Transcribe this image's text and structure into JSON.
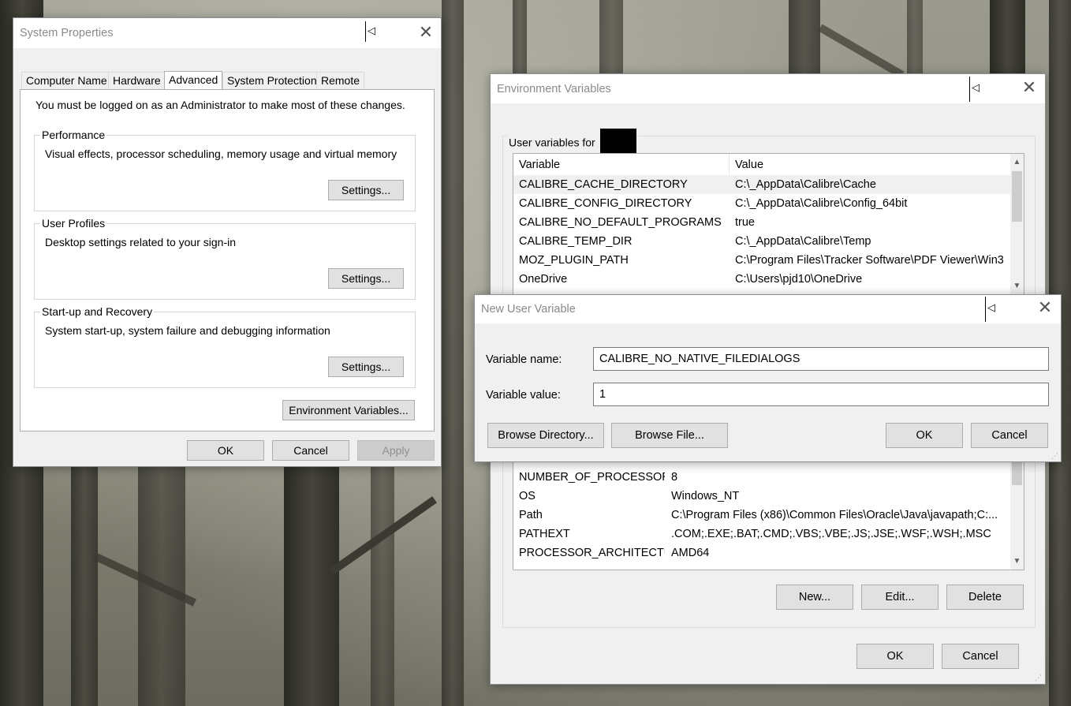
{
  "system_properties": {
    "title": "System Properties",
    "tabs": [
      "Computer Name",
      "Hardware",
      "Advanced",
      "System Protection",
      "Remote"
    ],
    "active_tab": "Advanced",
    "admin_note": "You must be logged on as an Administrator to make most of these changes.",
    "performance": {
      "title": "Performance",
      "desc": "Visual effects, processor scheduling, memory usage and virtual memory",
      "button": "Settings..."
    },
    "user_profiles": {
      "title": "User Profiles",
      "desc": "Desktop settings related to your sign-in",
      "button": "Settings..."
    },
    "startup_recovery": {
      "title": "Start-up and Recovery",
      "desc": "System start-up, system failure and debugging information",
      "button": "Settings..."
    },
    "env_vars_button": "Environment Variables...",
    "ok": "OK",
    "cancel": "Cancel",
    "apply": "Apply"
  },
  "environment_variables": {
    "title": "Environment Variables",
    "user_vars_label": "User variables for",
    "columns": {
      "variable": "Variable",
      "value": "Value"
    },
    "user_rows": [
      {
        "variable": "CALIBRE_CACHE_DIRECTORY",
        "value": "C:\\_AppData\\Calibre\\Cache"
      },
      {
        "variable": "CALIBRE_CONFIG_DIRECTORY",
        "value": "C:\\_AppData\\Calibre\\Config_64bit"
      },
      {
        "variable": "CALIBRE_NO_DEFAULT_PROGRAMS",
        "value": "true"
      },
      {
        "variable": "CALIBRE_TEMP_DIR",
        "value": "C:\\_AppData\\Calibre\\Temp"
      },
      {
        "variable": "MOZ_PLUGIN_PATH",
        "value": "C:\\Program Files\\Tracker Software\\PDF Viewer\\Win3"
      },
      {
        "variable": "OneDrive",
        "value": "C:\\Users\\pjd10\\OneDrive"
      }
    ],
    "system_rows": [
      {
        "variable": "NUMBER_OF_PROCESSORS",
        "value": "8"
      },
      {
        "variable": "OS",
        "value": "Windows_NT"
      },
      {
        "variable": "Path",
        "value": "C:\\Program Files (x86)\\Common Files\\Oracle\\Java\\javapath;C:..."
      },
      {
        "variable": "PATHEXT",
        "value": ".COM;.EXE;.BAT;.CMD;.VBS;.VBE;.JS;.JSE;.WSF;.WSH;.MSC"
      },
      {
        "variable": "PROCESSOR_ARCHITECTU...",
        "value": "AMD64"
      }
    ],
    "new_button": "New...",
    "edit_button": "Edit...",
    "delete_button": "Delete",
    "ok": "OK",
    "cancel": "Cancel"
  },
  "new_user_variable": {
    "title": "New User Variable",
    "name_label": "Variable name:",
    "name_value": "CALIBRE_NO_NATIVE_FILEDIALOGS",
    "value_label": "Variable value:",
    "value_value": "1",
    "browse_dir": "Browse Directory...",
    "browse_file": "Browse File...",
    "ok": "OK",
    "cancel": "Cancel"
  }
}
